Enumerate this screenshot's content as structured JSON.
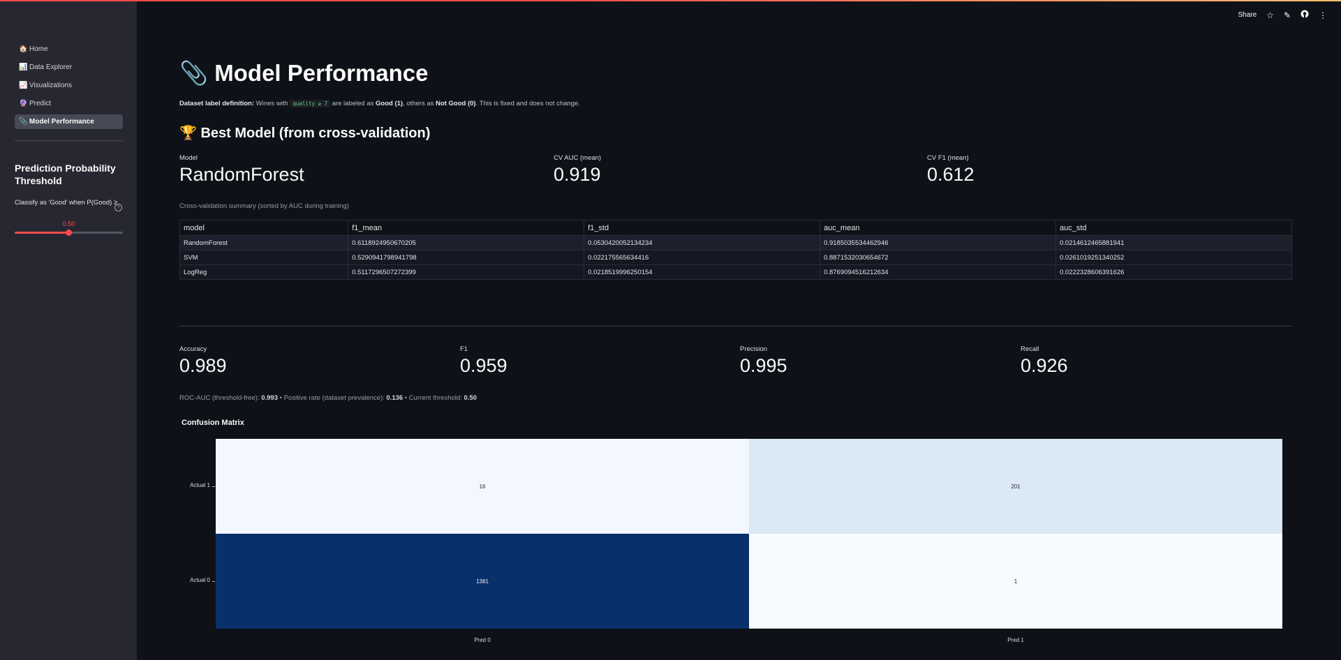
{
  "sidebar": {
    "nav": [
      {
        "icon": "🏠",
        "label": "Home"
      },
      {
        "icon": "📊",
        "label": "Data Explorer"
      },
      {
        "icon": "📈",
        "label": "Visualizations"
      },
      {
        "icon": "🔮",
        "label": "Predict"
      },
      {
        "icon": "📎",
        "label": "Model Performance"
      }
    ],
    "threshold_heading": "Prediction Probability Threshold",
    "threshold_label": "Classify as 'Good' when P(Good) ≥",
    "threshold_value": "0.50",
    "threshold_fraction": 0.5
  },
  "toolbar": {
    "share": "Share",
    "icons": [
      "star-icon",
      "edit-icon",
      "github-icon",
      "menu-icon"
    ]
  },
  "main": {
    "title_icon": "📎",
    "title": "Model Performance",
    "dataset_note": {
      "label": "Dataset label definition:",
      "text1": " Wines with ",
      "code": "quality ≥ 7",
      "text2": " are labeled as ",
      "good": "Good (1)",
      "text3": ", others as ",
      "notgood": "Not Good (0)",
      "text4": ". This is fixed and does not change."
    },
    "best_model_heading": "🏆 Best Model (from cross-validation)",
    "best_metrics": [
      {
        "label": "Model",
        "value": "RandomForest"
      },
      {
        "label": "CV AUC (mean)",
        "value": "0.919"
      },
      {
        "label": "CV F1 (mean)",
        "value": "0.612"
      }
    ],
    "cv_caption": "Cross-validation summary (sorted by AUC during training)",
    "cv_table": {
      "columns": [
        "model",
        "f1_mean",
        "f1_std",
        "auc_mean",
        "auc_std"
      ],
      "rows": [
        [
          "RandomForest",
          "0.6118924950670205",
          "0.0530420052134234",
          "0.9185035534462946",
          "0.0214612465881941"
        ],
        [
          "SVM",
          "0.5290941798941798",
          "0.022175565634416",
          "0.8871532030654672",
          "0.0261019251340252"
        ],
        [
          "LogReg",
          "0.5117296507272399",
          "0.0218519996250154",
          "0.8769094516212634",
          "0.0222328606391626"
        ]
      ]
    },
    "test_metrics": [
      {
        "label": "Accuracy",
        "value": "0.989"
      },
      {
        "label": "F1",
        "value": "0.959"
      },
      {
        "label": "Precision",
        "value": "0.995"
      },
      {
        "label": "Recall",
        "value": "0.926"
      }
    ],
    "stats": {
      "p1": "ROC-AUC (threshold-free): ",
      "auc": "0.993",
      "p2": " • Positive rate (dataset prevalence): ",
      "prev": "0.136",
      "p3": " • Current threshold: ",
      "thr": "0.50"
    },
    "confusion_matrix": {
      "title": "Confusion Matrix",
      "row_labels": [
        "Actual 1",
        "Actual 0"
      ],
      "col_labels": [
        "Pred 0",
        "Pred 1"
      ],
      "values": [
        [
          16,
          201
        ],
        [
          1381,
          1
        ]
      ],
      "colors": [
        [
          "#f3f8fe",
          "#dbe9f6"
        ],
        [
          "#08306b",
          "#f7fbff"
        ]
      ],
      "text_colors": [
        [
          "#262626",
          "#262626"
        ],
        [
          "#f0f0f0",
          "#262626"
        ]
      ]
    }
  }
}
